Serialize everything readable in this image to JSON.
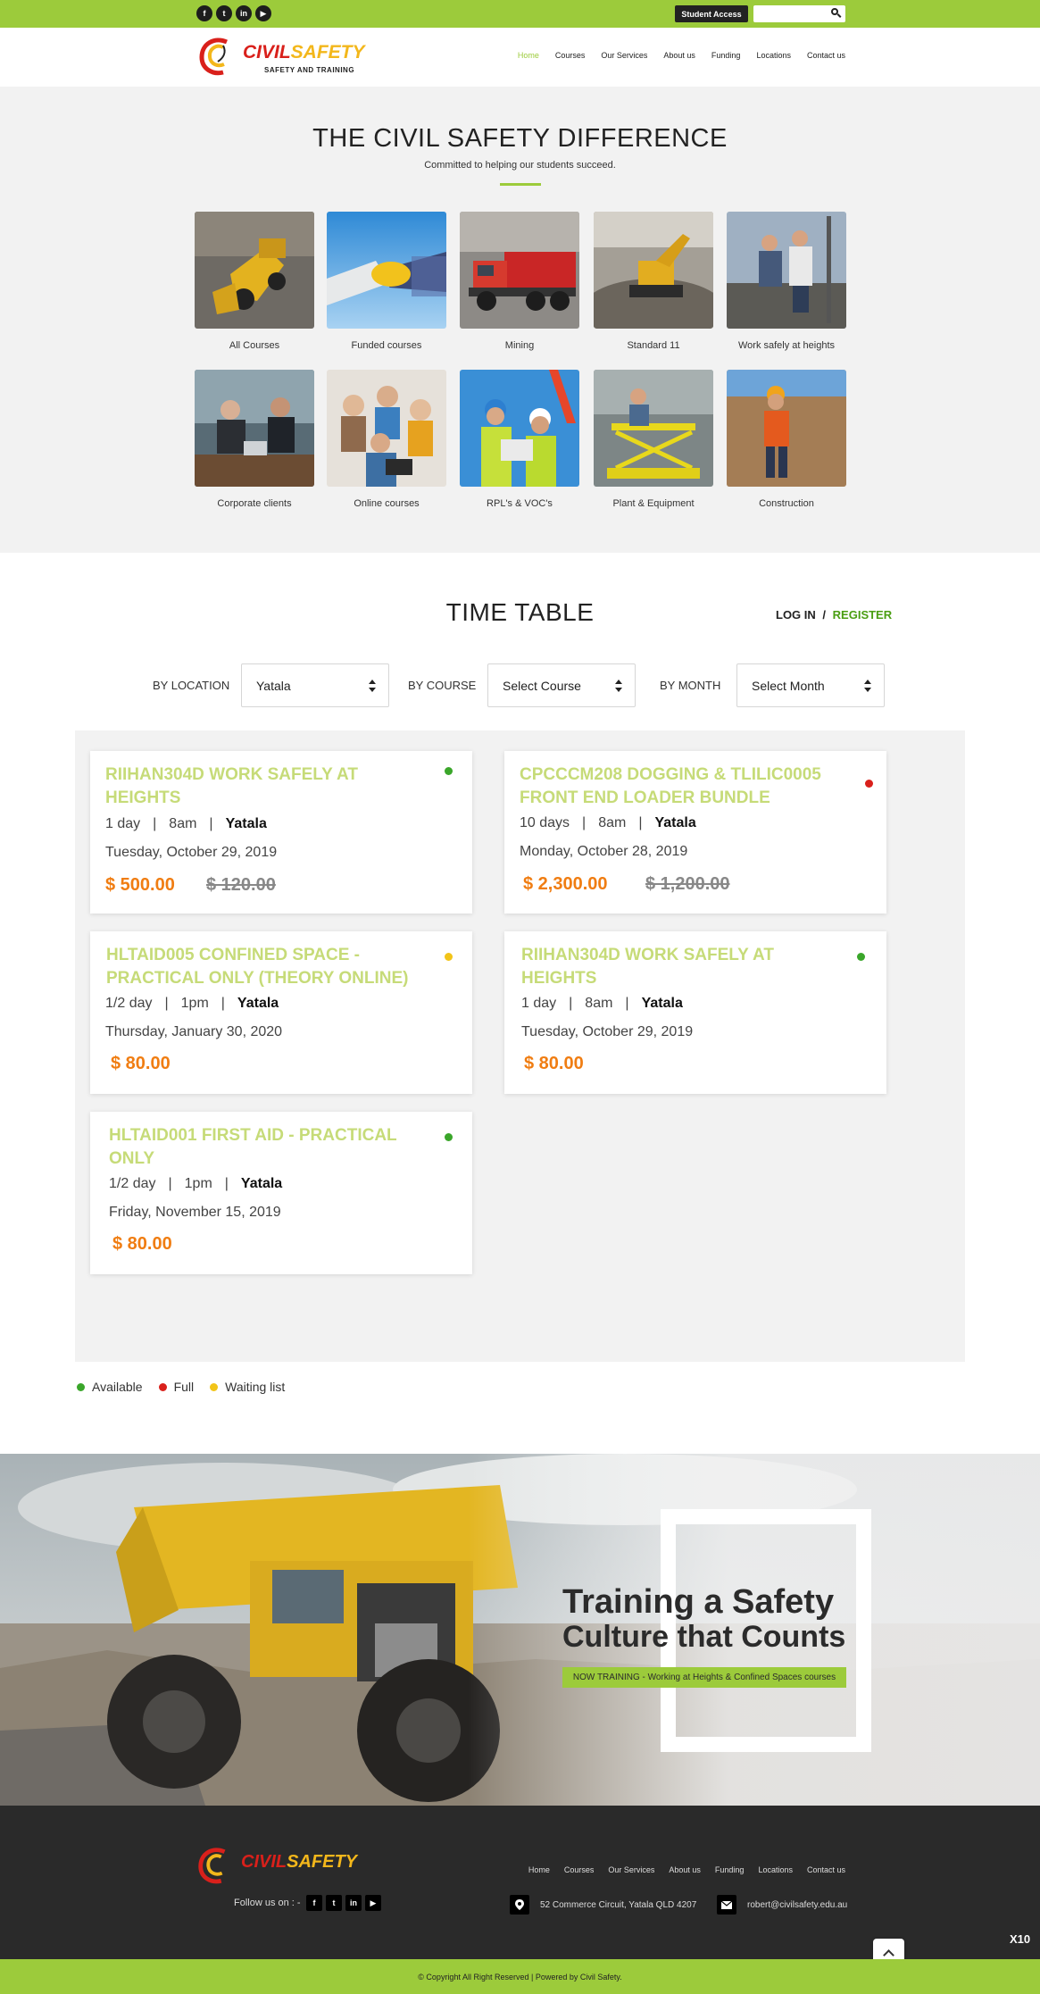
{
  "topbar": {
    "socials": [
      {
        "icon": "facebook-icon",
        "glyph": "f"
      },
      {
        "icon": "twitter-icon",
        "glyph": "t"
      },
      {
        "icon": "linkedin-icon",
        "glyph": "in"
      },
      {
        "icon": "youtube-icon",
        "glyph": "▶"
      }
    ],
    "student_access": "Student Access",
    "search_placeholder": ""
  },
  "header": {
    "logo": {
      "civil": "CIVIL",
      "safety": "SAFETY",
      "tagline": "SAFETY AND TRAINING"
    },
    "nav": [
      "Home",
      "Courses",
      "Our Services",
      "About us",
      "Funding",
      "Locations",
      "Contact us"
    ],
    "active_nav": "Home"
  },
  "difference": {
    "title": "THE CIVIL SAFETY DIFFERENCE",
    "subtitle": "Committed to helping our students succeed.",
    "categories": [
      {
        "label": "All Courses",
        "photo": "loader-photo-icon"
      },
      {
        "label": "Funded courses",
        "photo": "handshake-photo-icon"
      },
      {
        "label": "Mining",
        "photo": "truck-photo-icon"
      },
      {
        "label": "Standard 11",
        "photo": "excavator-photo-icon"
      },
      {
        "label": "Work safely at heights",
        "photo": "workers-photo-icon"
      },
      {
        "label": "Corporate clients",
        "photo": "meeting-photo-icon"
      },
      {
        "label": "Online courses",
        "photo": "students-photo-icon"
      },
      {
        "label": "RPL's & VOC's",
        "photo": "engineers-photo-icon"
      },
      {
        "label": "Plant & Equipment",
        "photo": "scissor-lift-photo-icon"
      },
      {
        "label": "Construction",
        "photo": "construction-photo-icon"
      }
    ]
  },
  "timetable": {
    "title": "TIME TABLE",
    "login": "LOG IN",
    "divider": "/",
    "register": "REGISTER",
    "filters": {
      "location_label": "BY LOCATION",
      "location_value": "Yatala",
      "course_label": "BY COURSE",
      "course_value": "Select Course",
      "month_label": "BY MONTH",
      "month_value": "Select Month"
    },
    "courses": [
      {
        "title": "RIIHAN304D WORK SAFELY AT HEIGHTS",
        "duration": "1 day",
        "time": "8am",
        "location": "Yatala",
        "date": "Tuesday, October 29, 2019",
        "price": "$ 500.00",
        "old_price": "$ 120.00",
        "status": "available"
      },
      {
        "title": "CPCCCM208 DOGGING & TLILIC0005 FRONT END LOADER BUNDLE",
        "duration": "10 days",
        "time": "8am",
        "location": "Yatala",
        "date": "Monday, October 28, 2019",
        "price": "$ 2,300.00",
        "old_price": "$ 1,200.00",
        "status": "full"
      },
      {
        "title": "HLTAID005 CONFINED SPACE - PRACTICAL ONLY (THEORY ONLINE)",
        "duration": "1/2 day",
        "time": "1pm",
        "location": "Yatala",
        "date": "Thursday, January 30, 2020",
        "price": "$ 80.00",
        "old_price": "",
        "status": "waiting"
      },
      {
        "title": "RIIHAN304D WORK SAFELY AT HEIGHTS",
        "duration": "1 day",
        "time": "8am",
        "location": "Yatala",
        "date": "Tuesday, October 29, 2019",
        "price": "$ 80.00",
        "old_price": "",
        "status": "available"
      },
      {
        "title": "HLTAID001 FIRST AID - PRACTICAL ONLY",
        "duration": "1/2 day",
        "time": "1pm",
        "location": "Yatala",
        "date": "Friday, November 15, 2019",
        "price": "$ 80.00",
        "old_price": "",
        "status": "available"
      }
    ],
    "legend": [
      {
        "label": "Available",
        "color": "#3aa62a"
      },
      {
        "label": "Full",
        "color": "#d9201b"
      },
      {
        "label": "Waiting list",
        "color": "#f2c418"
      }
    ]
  },
  "banner": {
    "line1": "Training a Safety",
    "line2": "Culture that Counts",
    "tag": "NOW TRAINING - Working at Heights & Confined Spaces courses"
  },
  "footer": {
    "logo": {
      "civil": "CIVIL",
      "safety": "SAFETY"
    },
    "follow": "Follow us on : -",
    "nav": [
      "Home",
      "Courses",
      "Our Services",
      "About us",
      "Funding",
      "Locations",
      "Contact us"
    ],
    "address": "52 Commerce Circuit, Yatala QLD 4207",
    "email": "robert@civilsafety.edu.au",
    "badge": "X10",
    "copyright": "© Copyright All Right Reserved | Powered by Civil Safety."
  },
  "colors": {
    "brand_green": "#9ccb3b",
    "title_green": "#c6db78",
    "price_orange": "#f07d12",
    "logo_red": "#d9201b",
    "logo_yellow": "#f3b71b"
  }
}
